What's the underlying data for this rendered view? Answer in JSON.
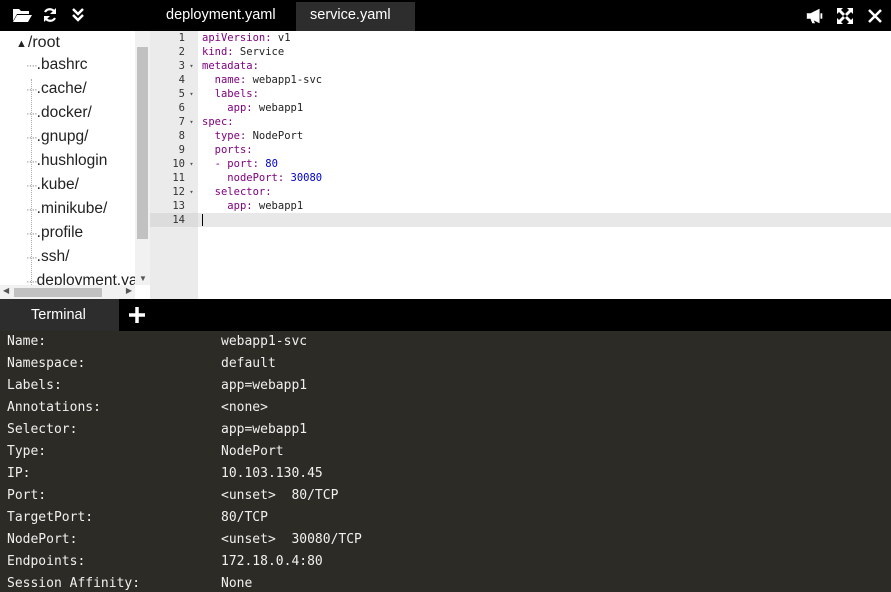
{
  "toolbar": {
    "left_icons": [
      "folder-open-icon",
      "refresh-icon",
      "collapse-icon"
    ],
    "right_icons": [
      "megaphone-icon",
      "fullscreen-icon",
      "close-icon"
    ]
  },
  "tabs": [
    {
      "label": "deployment.yaml",
      "active": false
    },
    {
      "label": "service.yaml",
      "active": true
    }
  ],
  "tree": {
    "root": "/root",
    "items": [
      ".bashrc",
      ".cache/",
      ".docker/",
      ".gnupg/",
      ".hushlogin",
      ".kube/",
      ".minikube/",
      ".profile",
      ".ssh/",
      "deployment.ya"
    ]
  },
  "editor": {
    "lines": [
      {
        "n": "1",
        "fold": "",
        "k": "apiVersion:",
        "v": " v1",
        "ind": ""
      },
      {
        "n": "2",
        "fold": "",
        "k": "kind:",
        "v": " Service",
        "ind": ""
      },
      {
        "n": "3",
        "fold": "▾",
        "k": "metadata:",
        "v": "",
        "ind": ""
      },
      {
        "n": "4",
        "fold": "",
        "k": "name:",
        "v": " webapp1-svc",
        "ind": "  "
      },
      {
        "n": "5",
        "fold": "▾",
        "k": "labels:",
        "v": "",
        "ind": "  "
      },
      {
        "n": "6",
        "fold": "",
        "k": "app:",
        "v": " webapp1",
        "ind": "    "
      },
      {
        "n": "7",
        "fold": "▾",
        "k": "spec:",
        "v": "",
        "ind": ""
      },
      {
        "n": "8",
        "fold": "",
        "k": "type:",
        "v": " NodePort",
        "ind": "  "
      },
      {
        "n": "9",
        "fold": "",
        "k": "ports:",
        "v": "",
        "ind": "  "
      },
      {
        "n": "10",
        "fold": "▾",
        "k": "- port:",
        "v": " 80",
        "ind": "  ",
        "num": true
      },
      {
        "n": "11",
        "fold": "",
        "k": "nodePort:",
        "v": " 30080",
        "ind": "    ",
        "num": true
      },
      {
        "n": "12",
        "fold": "▾",
        "k": "selector:",
        "v": "",
        "ind": "  "
      },
      {
        "n": "13",
        "fold": "",
        "k": "app:",
        "v": " webapp1",
        "ind": "    "
      },
      {
        "n": "14",
        "fold": "",
        "k": "",
        "v": "",
        "ind": ""
      }
    ]
  },
  "terminal": {
    "tab_label": "Terminal",
    "rows": [
      {
        "k": "Name:",
        "v": "webapp1-svc"
      },
      {
        "k": "Namespace:",
        "v": "default"
      },
      {
        "k": "Labels:",
        "v": "app=webapp1"
      },
      {
        "k": "Annotations:",
        "v": "<none>"
      },
      {
        "k": "Selector:",
        "v": "app=webapp1"
      },
      {
        "k": "Type:",
        "v": "NodePort"
      },
      {
        "k": "IP:",
        "v": "10.103.130.45"
      },
      {
        "k": "Port:",
        "v": "<unset>  80/TCP"
      },
      {
        "k": "TargetPort:",
        "v": "80/TCP"
      },
      {
        "k": "NodePort:",
        "v": "<unset>  30080/TCP"
      },
      {
        "k": "Endpoints:",
        "v": "172.18.0.4:80"
      },
      {
        "k": "Session Affinity:",
        "v": "None"
      }
    ]
  }
}
